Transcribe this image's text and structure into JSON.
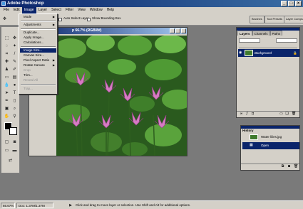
{
  "app": {
    "title": "Adobe Photoshop"
  },
  "menubar": [
    "File",
    "Edit",
    "Image",
    "Layer",
    "Select",
    "Filter",
    "View",
    "Window",
    "Help"
  ],
  "options": {
    "auto_select_layer": "Auto Select Layer",
    "show_bounding_box": "Show Bounding Box"
  },
  "palette_well": {
    "brushes": "Brushes",
    "presets": "Tool Presets",
    "comps": "Layer Comps"
  },
  "document": {
    "title": "p 66.7% (RGB/8#)"
  },
  "image_menu": {
    "mode": "Mode",
    "adjustments": "Adjustments",
    "duplicate": "Duplicate...",
    "apply_image": "Apply Image...",
    "calculations": "Calculations...",
    "image_size": "Image Size...",
    "canvas_size": "Canvas Size...",
    "pixel_aspect": "Pixel Aspect Ratio",
    "rotate_canvas": "Rotate Canvas",
    "crop": "Crop",
    "trim": "Trim...",
    "reveal_all": "Reveal All",
    "trap": "Trap..."
  },
  "layers_panel": {
    "tabs": [
      "Layers",
      "Channels",
      "Paths"
    ],
    "layer_name": "Background"
  },
  "history_panel": {
    "title": "History",
    "items": [
      "Water lilies.jpg",
      "Open"
    ]
  },
  "status": {
    "zoom": "66.67%",
    "doc": "Doc: 1.37M/1.37M",
    "hint": "Click and drag to move layer or selection.  Use Shift and Alt for additional options."
  }
}
